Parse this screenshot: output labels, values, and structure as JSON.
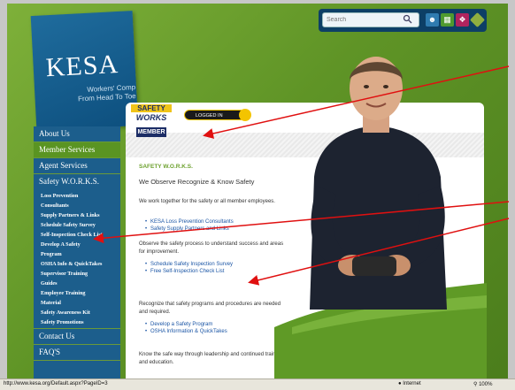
{
  "logo": {
    "brand": "KESA",
    "tagline_line1": "Workers' Comp",
    "tagline_line2": "From Head To Toe"
  },
  "toolbar": {
    "search_placeholder": "Search"
  },
  "sidebar": {
    "top_items": [
      {
        "label": "About Us"
      },
      {
        "label": "Member Services"
      },
      {
        "label": "Agent Services"
      },
      {
        "label": "Safety W.O.R.K.S."
      }
    ],
    "sub_items": [
      {
        "label": "Loss Prevention"
      },
      {
        "label": "Consultants"
      },
      {
        "label": "Supply Partners & Links"
      },
      {
        "label": "Schedule Safety Survey"
      },
      {
        "label": "Self-Inspection Check List"
      },
      {
        "label": "Develop A Safety"
      },
      {
        "label": "Program"
      },
      {
        "label": "OSHA Info & QuickTakes"
      },
      {
        "label": "Supervisor Training"
      },
      {
        "label": "Guides"
      },
      {
        "label": "Employee Training"
      },
      {
        "label": "Material"
      },
      {
        "label": "Safety Awareness Kit"
      },
      {
        "label": "Safety Promotions"
      }
    ],
    "bottom_items": [
      {
        "label": "Contact Us"
      },
      {
        "label": "FAQ'S"
      }
    ]
  },
  "badge": {
    "line1": "SAFETY",
    "line2": "WORKS",
    "line3": "MEMBER"
  },
  "logged_in": "LOGGED IN",
  "content": {
    "section_title": "SAFETY W.O.R.K.S.",
    "tagline": "We Observe Recognize & Know Safety",
    "p1": "We work together for the safety or all member employees.",
    "list1": [
      "KESA Loss Prevention Consultants",
      "Safety Supply Partners and Links"
    ],
    "p2": "Observe the safety process to understand success and areas for improvement.",
    "list2": [
      "Schedule Safety Inspection Survey",
      "Free Self-Inspection Check List"
    ],
    "p3": "Recognize that safety programs and procedures are needed and required.",
    "list3": [
      "Develop a Safety Program",
      "OSHA Information & QuickTakes"
    ],
    "p4": "Know the safe way through leadership and continued training and education."
  },
  "statusbar": {
    "url": "http://www.kesa.org/Default.aspx?PageID=3",
    "zone": "Internet",
    "zoom": "100%"
  },
  "colors": {
    "brand_blue": "#1c5e8c",
    "brand_green": "#6da12f",
    "arrow_red": "#e01010"
  }
}
